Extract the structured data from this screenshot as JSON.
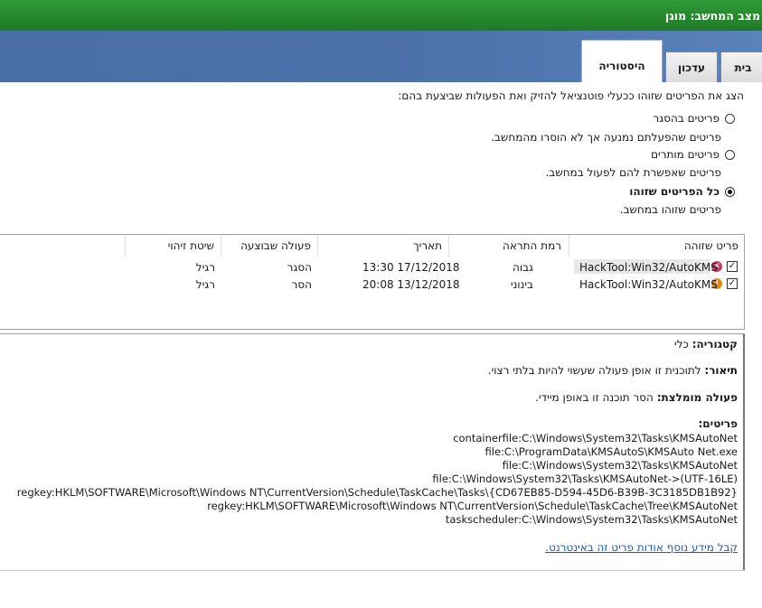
{
  "window": {
    "title": "מצב המחשב: מוגן"
  },
  "tabs": {
    "home": "בית",
    "update": "עדכון",
    "history": "היסטוריה"
  },
  "history": {
    "intro": "הצג את הפריטים שזוהו ככעלי פוטנציאל להזיק ואת הפעולות שביצעת בהם:",
    "options": [
      {
        "label": "פריטים בהסגר",
        "desc": "פריטים שהפעלתם נמנעה אך לא הוסרו מהמחשב.",
        "checked": false
      },
      {
        "label": "פריטים מותרים",
        "desc": "פריטים שאפשרת להם לפעול במחשב.",
        "checked": false
      },
      {
        "label": "כל הפריטים שזוהו",
        "desc": "פריטים שזוהו במחשב.",
        "checked": true
      }
    ]
  },
  "table": {
    "headers": {
      "item": "פריט שזוהה",
      "alert": "רמת התראה",
      "date": "תאריך",
      "action": "פעולה שבוצעה",
      "method": "שיטת זיהוי"
    },
    "rows": [
      {
        "item": "HackTool:Win32/AutoKMS",
        "alert": "גבוה",
        "date": "13:30 17/12/2018",
        "action": "הסגר",
        "method": "רגיל",
        "icon": "red-x-icon"
      },
      {
        "item": "HackTool:Win32/AutoKMS",
        "alert": "בינוני",
        "date": "20:08 13/12/2018",
        "action": "הסר",
        "method": "רגיל",
        "icon": "orange-warning-icon"
      }
    ]
  },
  "details": {
    "category_label": "קטגוריה:",
    "category_value": "כלי",
    "description_label": "תיאור:",
    "description_value": "לתוכנית זו אופן פעולה שעשוי להיות בלתי רצוי.",
    "recommended_label": "פעולה מומלצת:",
    "recommended_value": "הסר תוכנה זו באופן מיידי.",
    "items_label": "פריטים:",
    "items": [
      "containerfile:C:\\Windows\\System32\\Tasks\\KMSAutoNet",
      "file:C:\\ProgramData\\KMSAutoS\\KMSAuto Net.exe",
      "file:C:\\Windows\\System32\\Tasks\\KMSAutoNet",
      "file:C:\\Windows\\System32\\Tasks\\KMSAutoNet->(UTF-16LE)",
      "regkey:HKLM\\SOFTWARE\\Microsoft\\Windows NT\\CurrentVersion\\Schedule\\TaskCache\\Tasks\\{CD67EB85-D594-45D6-B39B-3C3185DB1B92}",
      "regkey:HKLM\\SOFTWARE\\Microsoft\\Windows NT\\CurrentVersion\\Schedule\\TaskCache\\Tree\\KMSAutoNet",
      "taskscheduler:C:\\Windows\\System32\\Tasks\\KMSAutoNet"
    ],
    "more_link": "קבל מידע נוסף אודות פריט זה באינטרנט."
  },
  "colors": {
    "titlebar": "#1f7a27",
    "band": "#4d73ab",
    "link": "#1f5bb8"
  }
}
